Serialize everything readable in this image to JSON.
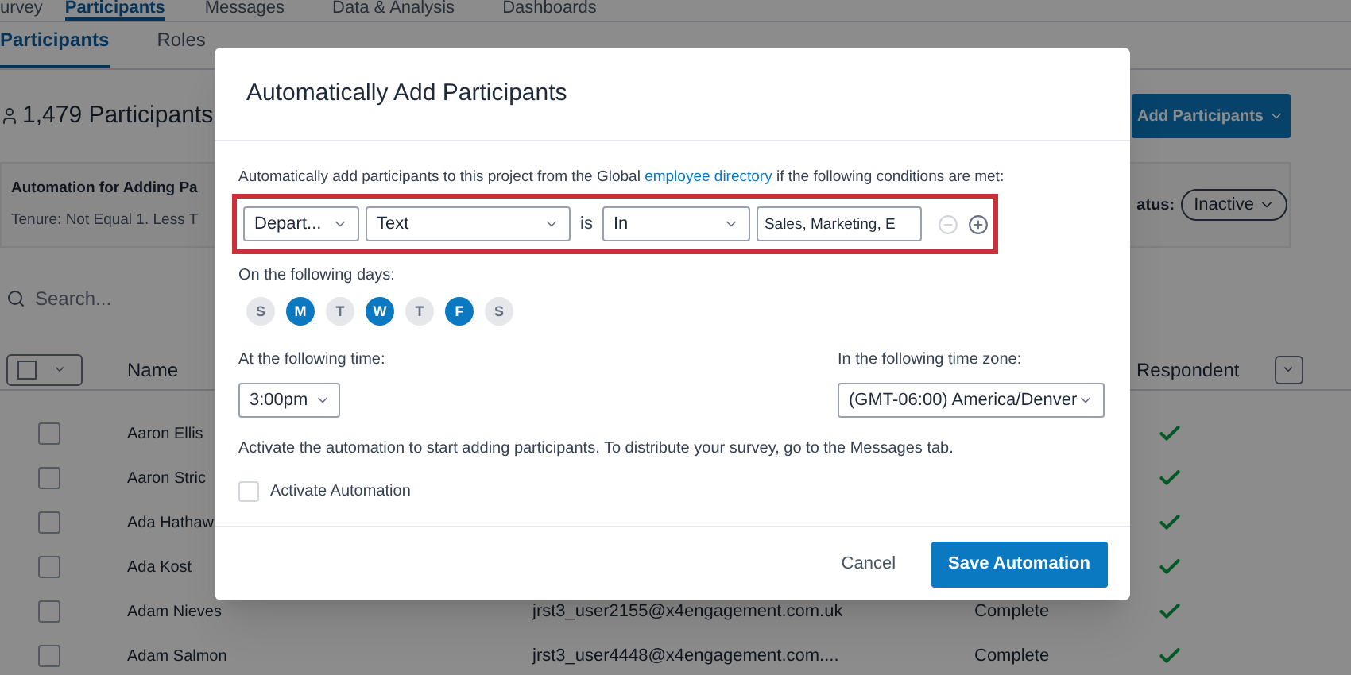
{
  "top_tabs": [
    {
      "label": "urvey",
      "selected": false
    },
    {
      "label": "Participants",
      "selected": true
    },
    {
      "label": "Messages",
      "selected": false
    },
    {
      "label": "Data & Analysis",
      "selected": false
    },
    {
      "label": "Dashboards",
      "selected": false
    }
  ],
  "sub_tabs": [
    {
      "label": "Participants",
      "selected": true
    },
    {
      "label": "Roles",
      "selected": false
    }
  ],
  "participant_count": "1,479 Participants",
  "add_button": "Add Participants",
  "automation_card": {
    "title": "Automation for Adding Pa",
    "rule": "Tenure: Not Equal 1. Less T",
    "status_label": "atus:",
    "status": "Inactive"
  },
  "search": {
    "placeholder": "Search..."
  },
  "table": {
    "select_all": {
      "checked": false
    },
    "columns": [
      "Name",
      "Respondent"
    ],
    "rows": [
      {
        "name": "Aaron Ellis",
        "checked": false,
        "respondent": true
      },
      {
        "name": "Aaron Stric",
        "checked": false,
        "respondent": true
      },
      {
        "name": "Ada Hathaw",
        "checked": false,
        "respondent": true
      },
      {
        "name": "Ada Kost",
        "checked": false,
        "respondent": true
      },
      {
        "name": "Adam Nieves",
        "email": "jrst3_user2155@x4engagement.com.uk",
        "status": "Complete",
        "checked": false,
        "respondent": true
      },
      {
        "name": "Adam Salmon",
        "email": "jrst3_user4448@x4engagement.com....",
        "status": "Complete",
        "checked": false,
        "respondent": true
      }
    ]
  },
  "dialog": {
    "title": "Automatically Add Participants",
    "intro_before": "Automatically add participants to this project from the Global",
    "intro_link": "employee directory",
    "intro_after": "if the following conditions are met:",
    "condition": {
      "field": "Depart...",
      "type": "Text",
      "connector": "is",
      "operator": "In",
      "value": "Sales, Marketing, E"
    },
    "days_label": "On the following days:",
    "days": [
      {
        "label": "S",
        "selected": false
      },
      {
        "label": "M",
        "selected": true
      },
      {
        "label": "T",
        "selected": false
      },
      {
        "label": "W",
        "selected": true
      },
      {
        "label": "T",
        "selected": false
      },
      {
        "label": "F",
        "selected": true
      },
      {
        "label": "S",
        "selected": false
      }
    ],
    "time_label": "At the following time:",
    "time": "3:00pm",
    "timezone_label": "In the following time zone:",
    "timezone": "(GMT-06:00) America/Denver",
    "note": "Activate the automation to start adding participants. To distribute your survey, go to the Messages tab.",
    "activate": {
      "label": "Activate Automation",
      "checked": false
    },
    "cancel": "Cancel",
    "save": "Save Automation"
  }
}
